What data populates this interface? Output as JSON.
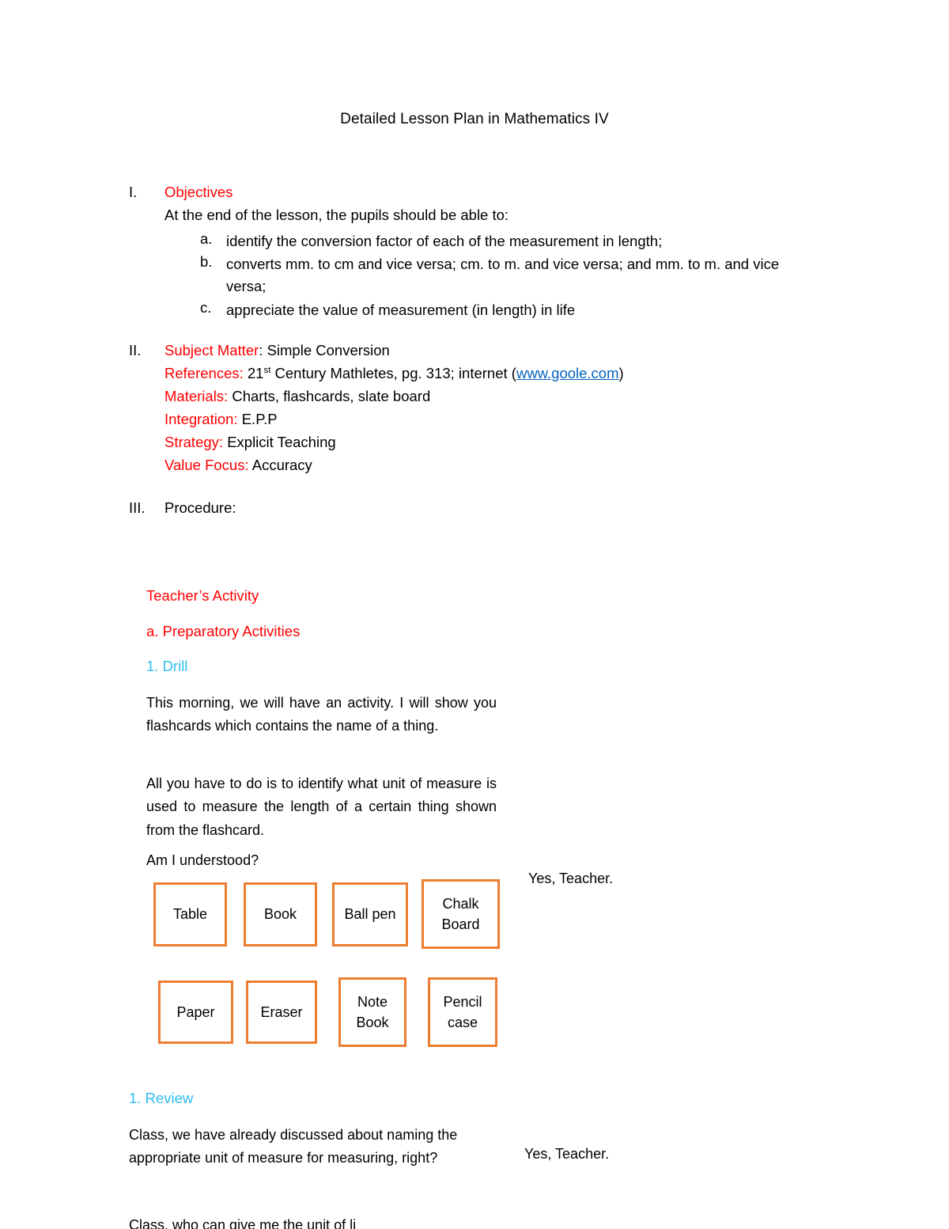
{
  "document": {
    "title": "Detailed Lesson Plan in Mathematics IV"
  },
  "sections": {
    "objectives": {
      "numeral": "I.",
      "heading": "Objectives",
      "intro": "At the end of the lesson, the pupils should be able to:",
      "items": [
        {
          "letter": "a.",
          "text": "identify the conversion factor of each of the measurement in length;"
        },
        {
          "letter": "b.",
          "text": "converts mm. to cm and vice versa; cm. to m. and vice versa; and mm. to m. and vice versa;"
        },
        {
          "letter": "c.",
          "text": "appreciate the value of measurement (in length) in life"
        }
      ]
    },
    "subject_matter": {
      "numeral": "II.",
      "lines": [
        {
          "label": "Subject Matter",
          "separator": ": ",
          "value": "Simple Conversion"
        },
        {
          "label": "References:",
          "separator": " ",
          "value_pre": "21",
          "value_sup": "st",
          "value_mid": " Century Mathletes, pg. 313; internet (",
          "link": "www.goole.com",
          "value_post": ")"
        },
        {
          "label": "Materials:",
          "separator": " ",
          "value": "Charts, flashcards, slate board"
        },
        {
          "label": "Integration:",
          "separator": " ",
          "value": "E.P.P"
        },
        {
          "label": "Strategy:",
          "separator": " ",
          "value": "Explicit Teaching"
        },
        {
          "label": "Value Focus:",
          "separator": " ",
          "value": "Accuracy"
        }
      ]
    },
    "procedure": {
      "numeral": "III.",
      "heading": "Procedure:"
    }
  },
  "activity": {
    "column_header": "Teacher’s Activity",
    "preparatory_heading": "a. Preparatory Activities",
    "drill_heading": "1. Drill",
    "drill_paragraph_1": "This morning, we will have an activity. I will show you flashcards which contains the name of a thing.",
    "drill_paragraph_2": "All you have to do is to identify what unit of measure is used to measure the length of a certain thing shown from the flashcard.",
    "drill_question": "Am I understood?",
    "drill_response": "Yes, Teacher.",
    "review_heading": "1. Review",
    "review_paragraph": "Class, we have already discussed about naming the appropriate unit of measure for measuring, right?",
    "review_response": "Yes, Teacher.",
    "clipped_line": "Class, who can give me the unit of li"
  },
  "flashcards": {
    "row1": [
      "Table",
      "Book",
      "Ball pen",
      "Chalk Board"
    ],
    "row2": [
      "Paper",
      "Eraser",
      "Note Book",
      "Pencil case"
    ]
  },
  "colors": {
    "heading_red": "#FF0000",
    "sub_heading_cyan": "#2CBEEF",
    "card_border_orange": "#ED7D31",
    "hyperlink_blue": "#0563C1",
    "text_black": "#000000",
    "page_background": "#FFFFFF"
  }
}
